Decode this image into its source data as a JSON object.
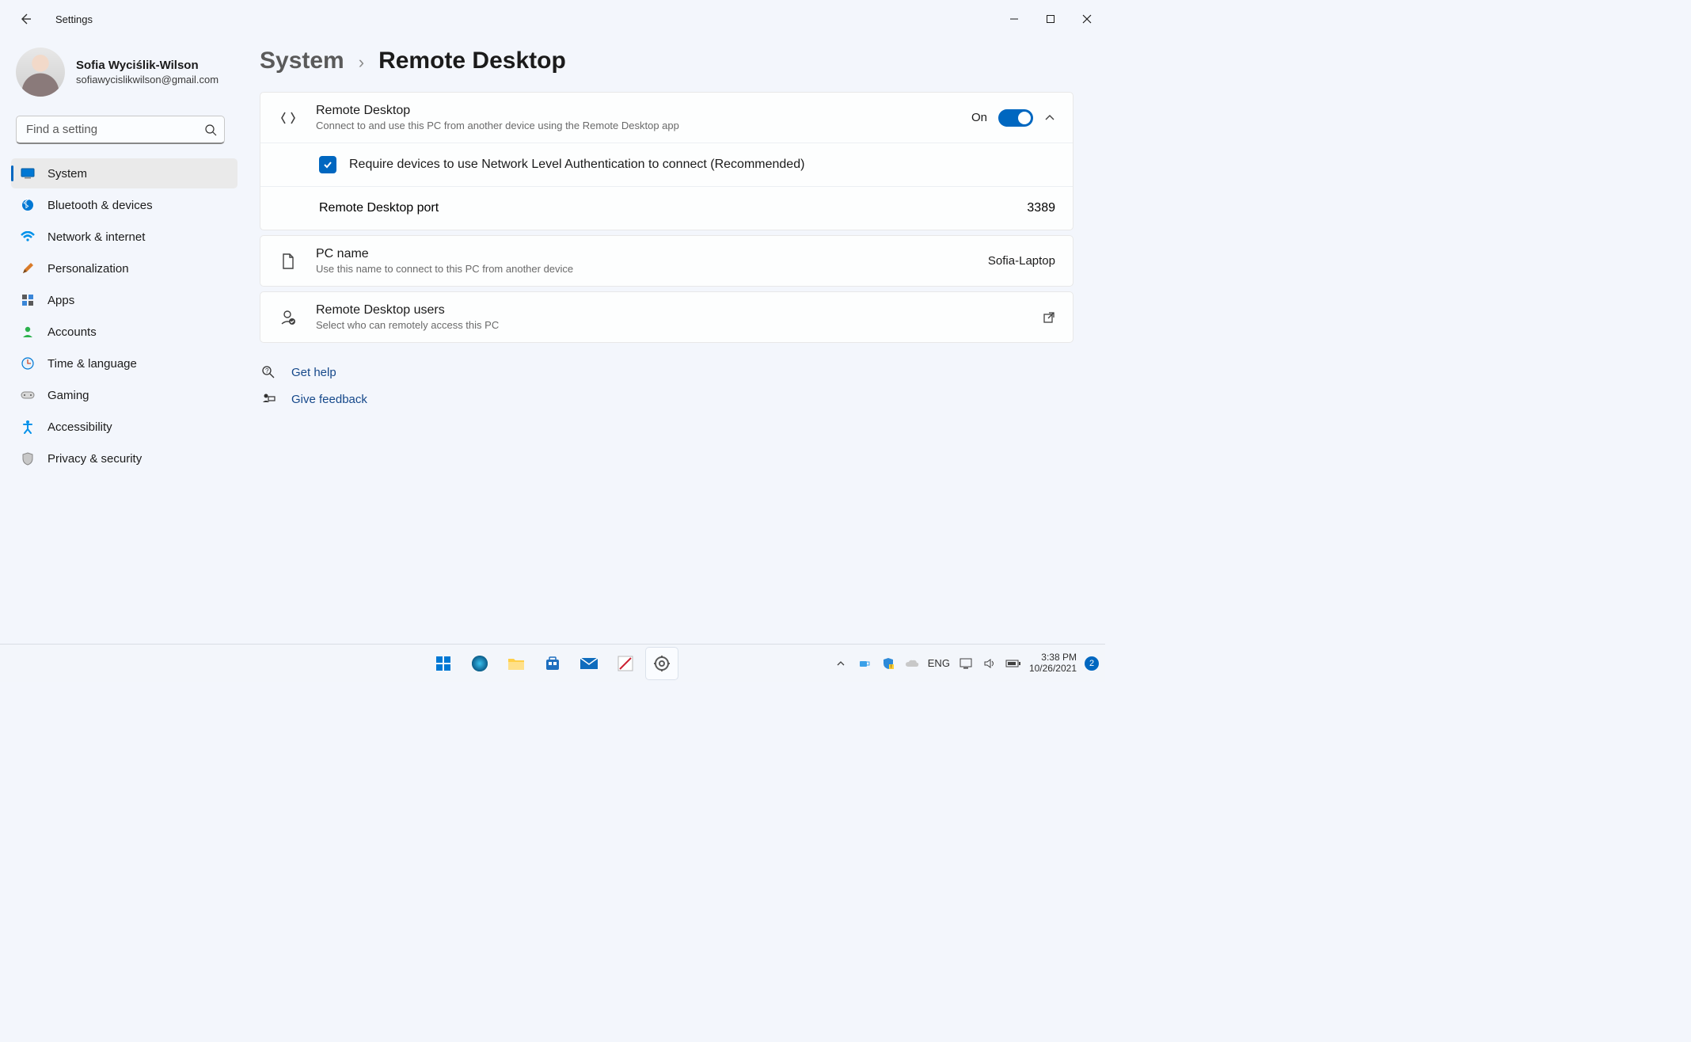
{
  "window": {
    "title": "Settings"
  },
  "profile": {
    "name": "Sofia Wyciślik-Wilson",
    "email": "sofiawycislikwilson@gmail.com"
  },
  "search": {
    "placeholder": "Find a setting"
  },
  "sidebar": {
    "items": [
      {
        "label": "System"
      },
      {
        "label": "Bluetooth & devices"
      },
      {
        "label": "Network & internet"
      },
      {
        "label": "Personalization"
      },
      {
        "label": "Apps"
      },
      {
        "label": "Accounts"
      },
      {
        "label": "Time & language"
      },
      {
        "label": "Gaming"
      },
      {
        "label": "Accessibility"
      },
      {
        "label": "Privacy & security"
      }
    ]
  },
  "breadcrumb": {
    "parent": "System",
    "current": "Remote Desktop"
  },
  "rd": {
    "title": "Remote Desktop",
    "subtitle": "Connect to and use this PC from another device using the Remote Desktop app",
    "state_label": "On",
    "nla_label": "Require devices to use Network Level Authentication to connect (Recommended)",
    "port_label": "Remote Desktop port",
    "port_value": "3389"
  },
  "pcname": {
    "title": "PC name",
    "subtitle": "Use this name to connect to this PC from another device",
    "value": "Sofia-Laptop"
  },
  "users": {
    "title": "Remote Desktop users",
    "subtitle": "Select who can remotely access this PC"
  },
  "links": {
    "help": "Get help",
    "feedback": "Give feedback"
  },
  "taskbar": {
    "lang": "ENG",
    "time": "3:38 PM",
    "date": "10/26/2021",
    "notif_count": "2"
  }
}
